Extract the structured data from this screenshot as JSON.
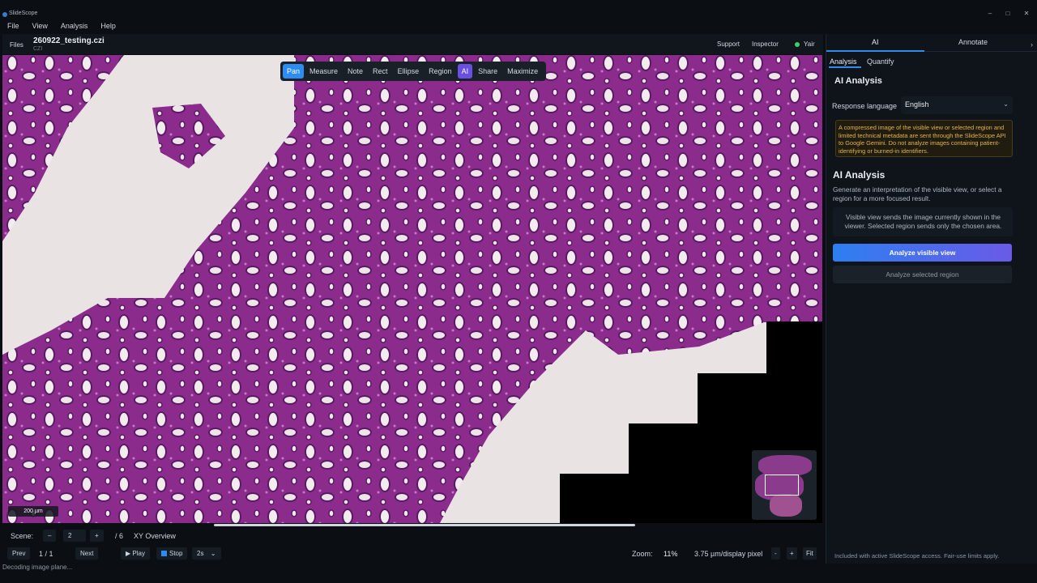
{
  "window": {
    "title": "SlideScope",
    "controls": [
      "–",
      "□",
      "✕"
    ]
  },
  "menu": [
    "File",
    "View",
    "Analysis",
    "Help"
  ],
  "file_bar": {
    "files_label": "Files",
    "file_name": "260922_testing.czi",
    "file_type": "CZI",
    "support_label": "Support",
    "inspector_label": "Inspector",
    "user_name": "Yair"
  },
  "toolbar": {
    "tools": [
      "Pan",
      "Measure",
      "Note",
      "Rect",
      "Ellipse",
      "Region",
      "AI",
      "Share",
      "Maximize"
    ],
    "active_tool": "Pan"
  },
  "viewer": {
    "scale_bar_label": "200 µm"
  },
  "scene_controls": {
    "scene_label": "Scene:",
    "minus": "–",
    "scene_value": "2",
    "plus": "+",
    "total": "/ 6",
    "overview_label": "XY Overview"
  },
  "playback": {
    "prev_label": "Prev",
    "page": "1 / 1",
    "next_label": "Next",
    "play_label": "▶ Play",
    "stop_label": "Stop",
    "interval": "2s",
    "zoom_label": "Zoom:",
    "zoom_value": "11%",
    "resolution": "3.75 µm/display pixel",
    "zoom_minus": "-",
    "zoom_plus": "+",
    "fit_label": "Fit"
  },
  "status": {
    "text": "Decoding image plane..."
  },
  "right_panel": {
    "tabs": [
      "AI",
      "Annotate"
    ],
    "subtabs": [
      "Analysis",
      "Quantify"
    ],
    "section_title": "AI Analysis",
    "language_label": "Response language",
    "language_value": "English",
    "warning": "A compressed image of the visible view or selected region and limited technical metadata are sent through the SlideScope API to Google Gemini. Do not analyze images containing patient-identifying or burned-in identifiers.",
    "ai_title": "AI Analysis",
    "ai_description": "Generate an interpretation of the visible view, or select a region for a more focused result.",
    "info": "Visible view sends the image currently shown in the viewer. Selected region sends only the chosen area.",
    "analyze_visible": "Analyze visible view",
    "analyze_selected": "Analyze selected region",
    "footer": "Included with active SlideScope access. Fair-use limits apply."
  },
  "colors": {
    "accent": "#2d8cf0",
    "ai_accent": "#6a4fe0",
    "tissue": "#8e2f8f",
    "warning_text": "#e0b44c"
  }
}
